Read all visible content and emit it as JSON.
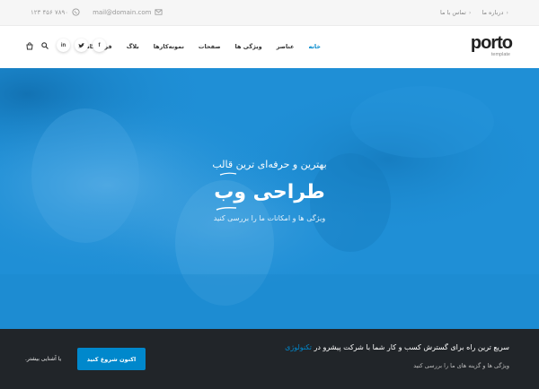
{
  "topbar": {
    "phone": "۱۲۳ ۴۵۶ ۷۸۹۰",
    "email": "mail@domain.com",
    "links": [
      "درباره ما",
      "تماس با ما"
    ]
  },
  "header": {
    "logo_word": "porto",
    "logo_sub": "template",
    "nav": [
      "خانه",
      "عناصر",
      "ویژگی ها",
      "صفحات",
      "نمونه‌کارها",
      "بلاگ",
      "فروشگاه"
    ],
    "active_nav": "خانه",
    "social": [
      "f",
      "t",
      "in"
    ],
    "icons": {
      "cart": "cart-icon",
      "search": "search-icon",
      "facebook": "facebook-icon",
      "twitter": "twitter-icon",
      "linkedin": "linkedin-icon",
      "whatsapp": "whatsapp-icon",
      "envelope": "envelope-icon"
    }
  },
  "hero": {
    "subtitle": "بهترین و حرفه‌ای ترین قالب",
    "title": "طراحی وب",
    "description": "ویژگی ها و امکانات ما را بررسی کنید"
  },
  "cta": {
    "title_main": "سریع ترین راه برای گسترش کسب و کار شما با شرکت پیشرو در",
    "title_highlight": "تکنولوژی",
    "description": "ویژگی ها و گزینه های ما را بررسی کنید",
    "button": "اکنون شروع کنید",
    "more": "یا آشنایی بیشتر."
  },
  "colors": {
    "accent": "#0088cc",
    "dark": "#212529",
    "hero": "#1f8fd6"
  }
}
